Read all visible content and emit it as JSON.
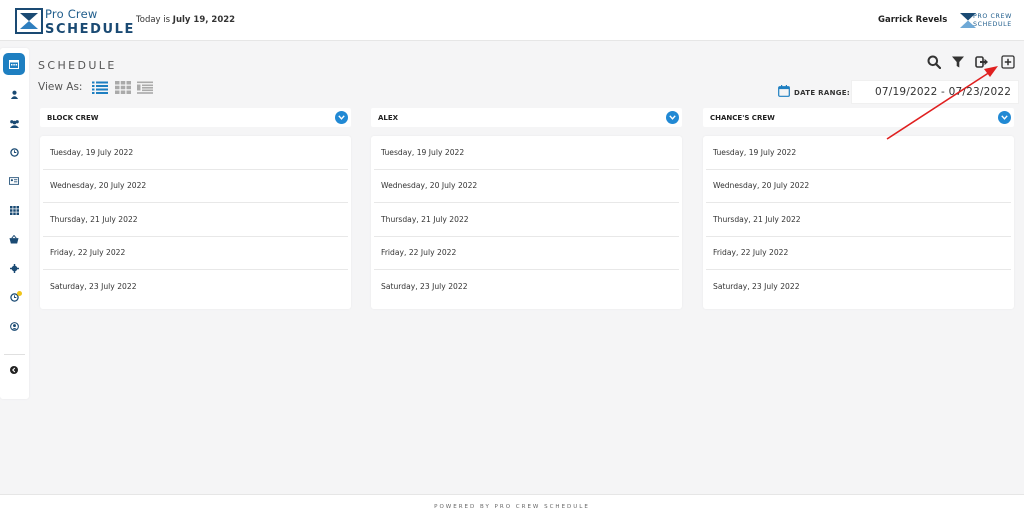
{
  "header": {
    "brand_line1": "Pro Crew",
    "brand_line2": "SCHEDULE",
    "today_prefix": "Today is",
    "today_date": "July 19, 2022",
    "user_name": "Garrick Revels",
    "small_brand_line1": "PRO CREW",
    "small_brand_line2": "SCHEDULE"
  },
  "sidebar": {
    "items": [
      "calendar-icon",
      "user-icon",
      "users-icon",
      "clock-icon",
      "id-card-icon",
      "grid-icon",
      "basket-icon",
      "gear-icon",
      "clock-alert-icon",
      "user-circle-icon",
      "chevron-left-icon"
    ]
  },
  "page": {
    "title": "SCHEDULE",
    "view_as_label": "View As:",
    "date_range_label": "DATE RANGE:",
    "date_range_value": "07/19/2022 - 07/23/2022"
  },
  "toolbar": {
    "icons": [
      "search-icon",
      "filter-icon",
      "export-icon",
      "add-icon"
    ]
  },
  "columns": [
    {
      "title": "BLOCK CREW",
      "days": [
        "Tuesday, 19 July 2022",
        "Wednesday, 20 July 2022",
        "Thursday, 21 July 2022",
        "Friday, 22 July 2022",
        "Saturday, 23 July 2022"
      ]
    },
    {
      "title": "ALEX",
      "days": [
        "Tuesday, 19 July 2022",
        "Wednesday, 20 July 2022",
        "Thursday, 21 July 2022",
        "Friday, 22 July 2022",
        "Saturday, 23 July 2022"
      ]
    },
    {
      "title": "CHANCE'S CREW",
      "days": [
        "Tuesday, 19 July 2022",
        "Wednesday, 20 July 2022",
        "Thursday, 21 July 2022",
        "Friday, 22 July 2022",
        "Saturday, 23 July 2022"
      ]
    }
  ],
  "footer": {
    "text": "POWERED BY PRO CREW SCHEDULE"
  },
  "colors": {
    "accent": "#1e7fc1",
    "brand": "#1a4a73",
    "annotation_arrow": "#e02020",
    "badge": "#f0c419"
  }
}
